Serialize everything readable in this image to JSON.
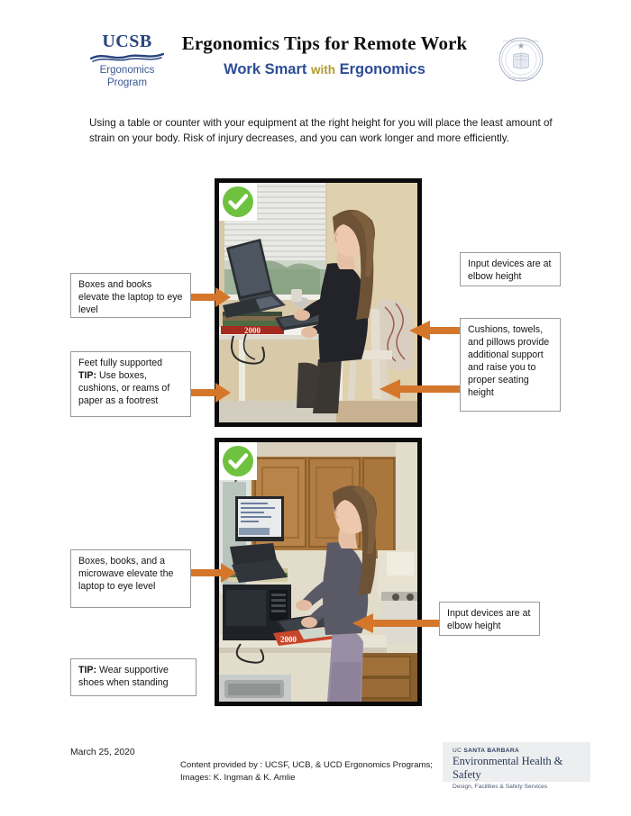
{
  "document": {
    "title": "Ergonomics Tips for Remote Work",
    "subtitle_main": "Work Smart",
    "subtitle_conjunction": "with",
    "subtitle_end": "Ergonomics"
  },
  "logo": {
    "wordmark": "UCSB",
    "line1": "Ergonomics",
    "line2": "Program",
    "seal_name": "uc-seal-icon"
  },
  "intro": {
    "paragraph": "Using a table or counter with your equipment at the right height for you will place the least amount of strain on your body. Risk of injury decreases, and you can work longer and more efficiently."
  },
  "photos": [
    {
      "id": "seated-workstation",
      "badge": "check-mark",
      "caption": "Woman seated at a white table, laptop elevated on a stack of books with an external keyboard and mouse, window with blinds behind"
    },
    {
      "id": "standing-workstation",
      "badge": "check-mark",
      "caption": "Woman standing at a kitchen counter, laptop elevated on a microwave and books, external keyboard on a puzzle box"
    }
  ],
  "callouts": [
    {
      "id": "boxes-books-laptop",
      "text": "Boxes and books elevate the laptop to eye level",
      "bold_prefix": ""
    },
    {
      "id": "feet-supported",
      "text": "Feet fully supported",
      "bold_prefix": "TIP:",
      "text2": " Use boxes, cushions, or reams of paper as a footrest"
    },
    {
      "id": "input-devices-seated",
      "text": "Input devices are at elbow height",
      "bold_prefix": ""
    },
    {
      "id": "cushions-towels-pillows",
      "text": "Cushions, towels, and pillows provide additional support and raise you to proper seating height",
      "bold_prefix": ""
    },
    {
      "id": "boxes-books-microwave",
      "text": "Boxes, books, and a microwave elevate the laptop to eye level",
      "bold_prefix": ""
    },
    {
      "id": "supportive-shoes",
      "bold_prefix": "TIP:",
      "text2": " Wear supportive shoes when standing"
    },
    {
      "id": "input-devices-standing",
      "text": "Input devices are at elbow height",
      "bold_prefix": ""
    }
  ],
  "footer": {
    "date": "March 25, 2020",
    "credit_line1": "Content provided by : UCSF, UCB, & UCD Ergonomics Programs;",
    "credit_line2": "Images: K. Ingman & K. Amlie",
    "ehs_uc": "UC ",
    "ehs_campus": "SANTA BARBARA",
    "ehs_title": "Environmental Health & Safety",
    "ehs_services": "Design, Facilities & Safety Services"
  },
  "colors": {
    "arrow": "#D4772B",
    "check_green": "#6FC23F",
    "ucsb_blue": "#28457E",
    "subtitle_blue": "#2D4D96",
    "subtitle_gold": "#B49B30",
    "ehs_navy": "#2C3A57"
  }
}
